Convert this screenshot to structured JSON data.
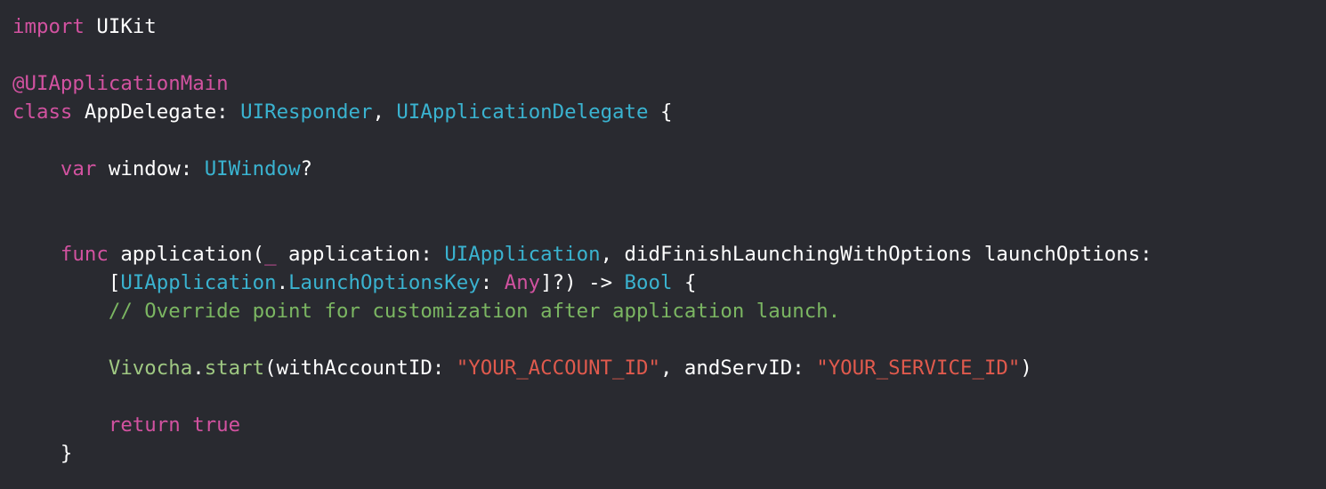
{
  "colors": {
    "background": "#292a30",
    "plain": "#ffffff",
    "keyword": "#d252a0",
    "type": "#3ab3d0",
    "attribute": "#d252a0",
    "comment": "#7bb662",
    "string": "#e05a4d",
    "call": "#9fc882"
  },
  "lines": [
    [
      {
        "t": "import",
        "c": "keyword"
      },
      {
        "t": " UIKit",
        "c": "plain"
      }
    ],
    [],
    [
      {
        "t": "@UIApplicationMain",
        "c": "attribute"
      }
    ],
    [
      {
        "t": "class",
        "c": "keyword"
      },
      {
        "t": " AppDelegate: ",
        "c": "plain"
      },
      {
        "t": "UIResponder",
        "c": "type"
      },
      {
        "t": ", ",
        "c": "plain"
      },
      {
        "t": "UIApplicationDelegate",
        "c": "type"
      },
      {
        "t": " {",
        "c": "plain"
      }
    ],
    [],
    [
      {
        "t": "    ",
        "c": "plain"
      },
      {
        "t": "var",
        "c": "keyword"
      },
      {
        "t": " window: ",
        "c": "plain"
      },
      {
        "t": "UIWindow",
        "c": "type"
      },
      {
        "t": "?",
        "c": "plain"
      }
    ],
    [],
    [],
    [
      {
        "t": "    ",
        "c": "plain"
      },
      {
        "t": "func",
        "c": "keyword"
      },
      {
        "t": " application(",
        "c": "plain"
      },
      {
        "t": "_",
        "c": "keyword"
      },
      {
        "t": " application: ",
        "c": "plain"
      },
      {
        "t": "UIApplication",
        "c": "type"
      },
      {
        "t": ", didFinishLaunchingWithOptions launchOptions:",
        "c": "plain"
      }
    ],
    [
      {
        "t": "        [",
        "c": "plain"
      },
      {
        "t": "UIApplication",
        "c": "type"
      },
      {
        "t": ".",
        "c": "plain"
      },
      {
        "t": "LaunchOptionsKey",
        "c": "type"
      },
      {
        "t": ": ",
        "c": "plain"
      },
      {
        "t": "Any",
        "c": "keyword"
      },
      {
        "t": "]?) -> ",
        "c": "plain"
      },
      {
        "t": "Bool",
        "c": "type"
      },
      {
        "t": " {",
        "c": "plain"
      }
    ],
    [
      {
        "t": "        ",
        "c": "plain"
      },
      {
        "t": "// Override point for customization after application launch.",
        "c": "comment"
      }
    ],
    [],
    [
      {
        "t": "        ",
        "c": "plain"
      },
      {
        "t": "Vivocha",
        "c": "call"
      },
      {
        "t": ".",
        "c": "plain"
      },
      {
        "t": "start",
        "c": "call"
      },
      {
        "t": "(withAccountID: ",
        "c": "plain"
      },
      {
        "t": "\"YOUR_ACCOUNT_ID\"",
        "c": "string"
      },
      {
        "t": ", andServID: ",
        "c": "plain"
      },
      {
        "t": "\"YOUR_SERVICE_ID\"",
        "c": "string"
      },
      {
        "t": ")",
        "c": "plain"
      }
    ],
    [],
    [
      {
        "t": "        ",
        "c": "plain"
      },
      {
        "t": "return",
        "c": "keyword"
      },
      {
        "t": " ",
        "c": "plain"
      },
      {
        "t": "true",
        "c": "keyword"
      }
    ],
    [
      {
        "t": "    }",
        "c": "plain"
      }
    ]
  ]
}
